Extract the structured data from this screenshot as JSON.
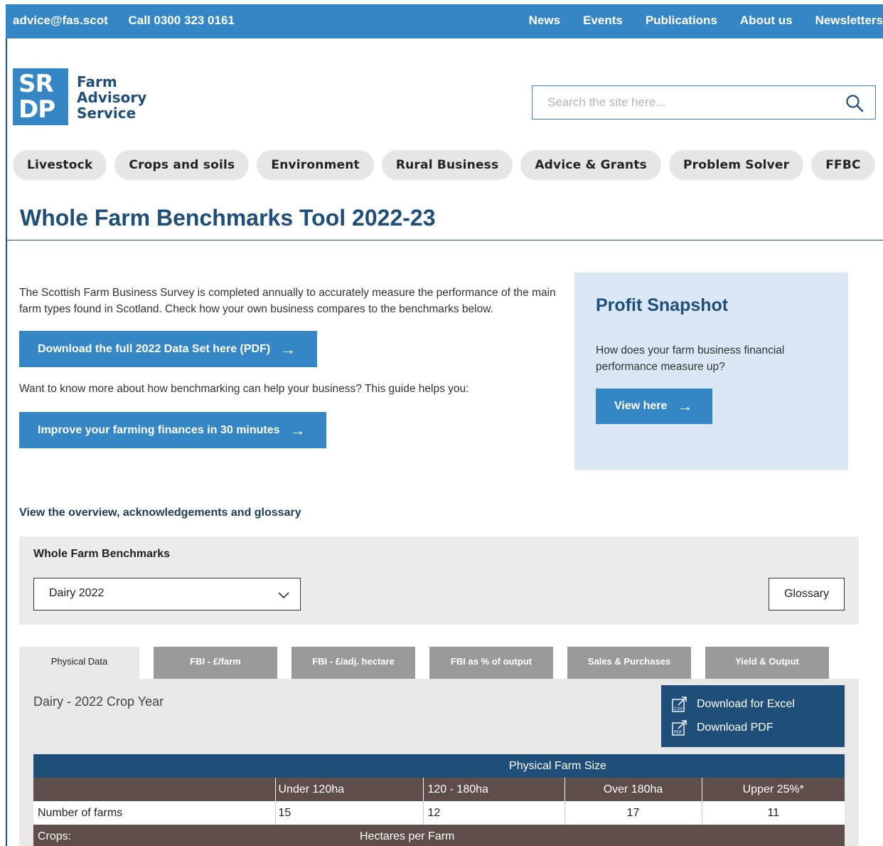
{
  "topbar": {
    "email": "advice@fas.scot",
    "phone": "Call 0300 323 0161",
    "links": [
      "News",
      "Events",
      "Publications",
      "About us",
      "Newsletters"
    ]
  },
  "logo": {
    "mark_top": "SR",
    "mark_bottom": "DP",
    "line1": "Farm",
    "line2": "Advisory",
    "line3": "Service"
  },
  "search": {
    "placeholder": "Search the site here..."
  },
  "nav": [
    "Livestock",
    "Crops and soils",
    "Environment",
    "Rural Business",
    "Advice & Grants",
    "Problem Solver",
    "FFBC"
  ],
  "page": {
    "title": "Whole Farm Benchmarks Tool 2022-23",
    "intro": "The Scottish Farm Business Survey is completed annually to accurately measure the performance of the main farm types found in Scotland. Check how your own business compares to the benchmarks below.",
    "download_btn": "Download the full 2022 Data Set here (PDF)",
    "guide_text": "Want to know more about how benchmarking can help your business? This guide helps you:",
    "guide_btn": "Improve your farming finances in 30 minutes",
    "overview_link": "View the overview, acknowledgements and glossary"
  },
  "snapshot": {
    "title": "Profit Snapshot",
    "text": "How does your farm business financial performance measure up?",
    "button": "View here"
  },
  "benchmarks": {
    "label": "Whole Farm Benchmarks",
    "selected": "Dairy 2022",
    "glossary": "Glossary"
  },
  "tabs": [
    "Physical Data",
    "FBI - £/farm",
    "FBI - £/adj. hectare",
    "FBI as % of output",
    "Sales & Purchases",
    "Yield & Output"
  ],
  "data": {
    "crop_year": "Dairy - 2022 Crop Year",
    "download_excel": "Download for Excel",
    "download_pdf": "Download PDF",
    "table_header": "Physical Farm Size",
    "columns": [
      "",
      "Under 120ha",
      "120 - 180ha",
      "Over 180ha",
      "Upper 25%*"
    ],
    "rows": [
      [
        "Number of farms",
        "15",
        "12",
        "17",
        "11"
      ]
    ],
    "section_label": "Crops:",
    "section_header": "Hectares per Farm"
  },
  "colors": {
    "brand_blue": "#3487c4",
    "navy": "#1f4e79",
    "table_brown": "#5f4d4a",
    "snapshot_bg": "#d9e8f4"
  }
}
